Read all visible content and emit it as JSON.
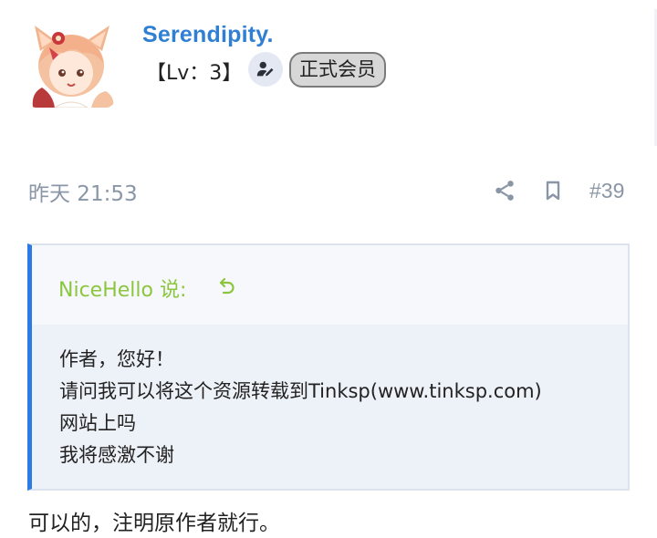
{
  "post": {
    "author": {
      "name": "Serendipity.",
      "level": "【Lv：3】",
      "badge": "正式会员",
      "avatar_icon": "anime-fox-girl-avatar"
    },
    "time": "昨天 21:53",
    "number": "#39",
    "actions": {
      "share_icon": "share-icon",
      "bookmark_icon": "bookmark-icon"
    },
    "quote": {
      "author": "NiceHello 说:",
      "jump_icon": "back-arrow-icon",
      "lines": [
        "作者，您好！",
        "请问我可以将这个资源转载到Tinksp(www.tinksp.com)",
        "网站上吗",
        "我将感激不谢"
      ]
    },
    "reply": "可以的，注明原作者就行。"
  },
  "colors": {
    "username": "#2f7fd2",
    "quote_author": "#8cc63f",
    "quote_border": "#2c7be5",
    "meta_text": "#8a96a6"
  }
}
